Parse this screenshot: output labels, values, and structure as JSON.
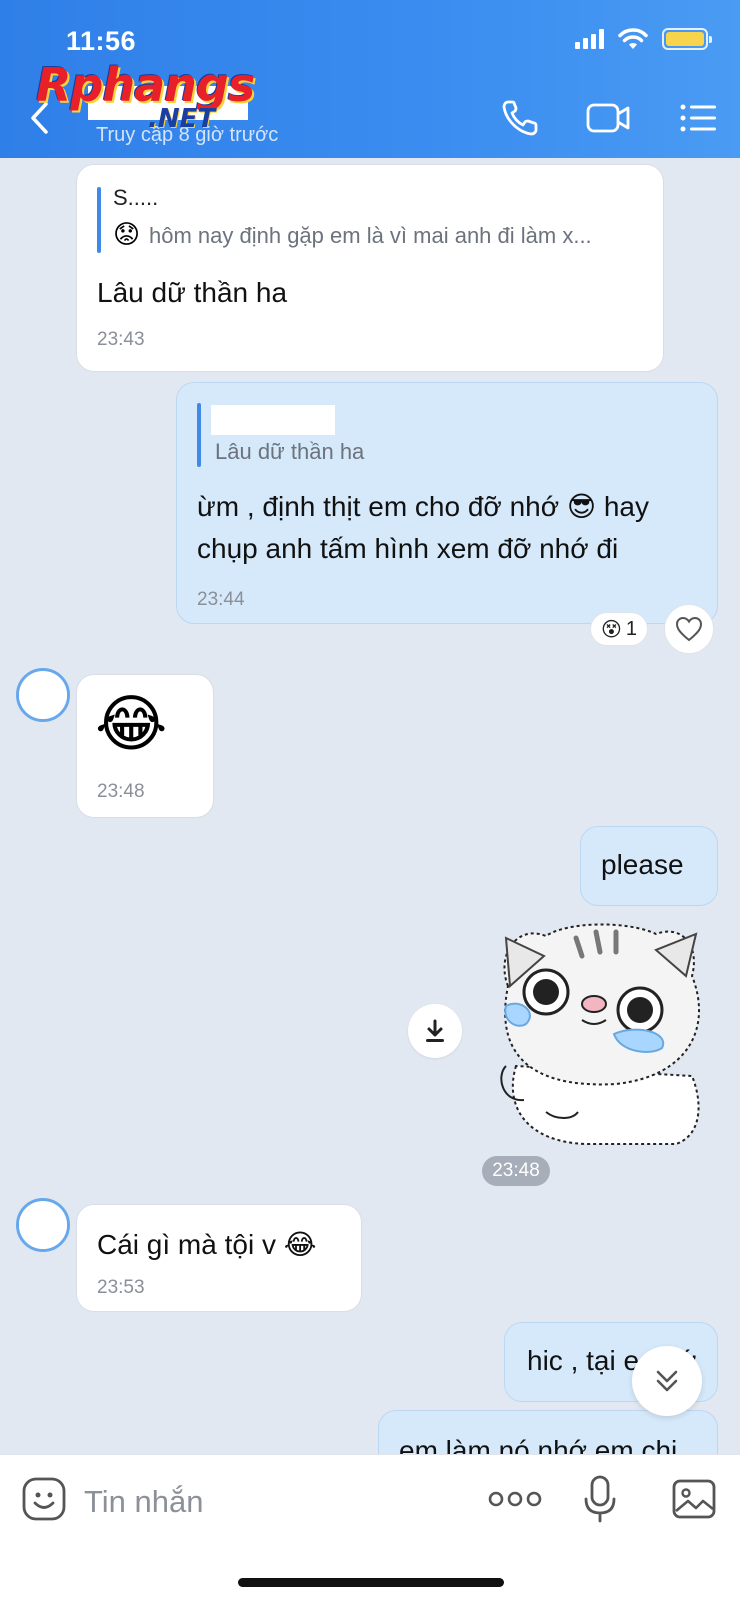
{
  "status_bar": {
    "time": "11:56",
    "battery_color": "#f7d44c"
  },
  "header": {
    "logo_main": "Rphangs",
    "logo_sub": ".NET",
    "last_seen": "Truy cập 8 giờ trước",
    "icons": [
      "back-arrow-icon",
      "phone-icon",
      "video-call-icon",
      "menu-icon"
    ]
  },
  "messages": [
    {
      "side": "in",
      "quote_name": "S.....",
      "quote_text": "hôm nay định gặp em là vì mai anh đi làm x...",
      "text": "Lâu dữ thần ha",
      "time": "23:43"
    },
    {
      "side": "out",
      "quote_text": "Lâu dữ thần ha",
      "text_line1": "ừm , định thịt em cho đỡ nhớ",
      "text_line1b": "hay",
      "text_line2": "chụp anh tấm hình xem đỡ nhớ đi",
      "time": "23:44",
      "reaction_count": "1"
    },
    {
      "side": "in",
      "emoji": "😂",
      "time": "23:48"
    },
    {
      "side": "out",
      "text": "please"
    },
    {
      "side": "out",
      "type": "sticker",
      "time": "23:48"
    },
    {
      "side": "in",
      "text": "Cái gì mà tội v",
      "time": "23:53"
    },
    {
      "side": "out",
      "text": "hic , tại e nhớ"
    },
    {
      "side": "out",
      "text": "em làm nó nhớ em chi"
    }
  ],
  "input": {
    "placeholder": "Tin nhắn"
  },
  "colors": {
    "header": "#3b8df0",
    "incoming": "#ffffff",
    "outgoing": "#d5e9fb",
    "background": "#e2e8f1",
    "accent": "#3f8ae6"
  }
}
